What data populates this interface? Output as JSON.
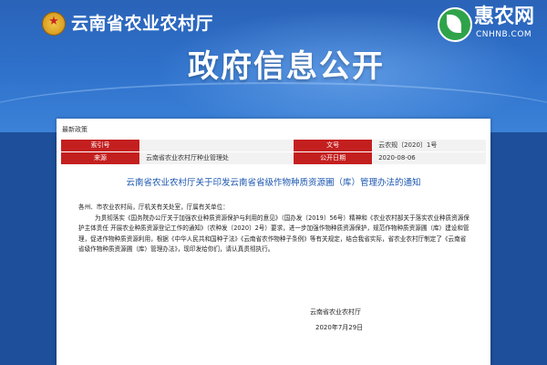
{
  "header": {
    "ministry_name": "云南省农业农村厅",
    "banner_title": "政府信息公开",
    "brand_name": "惠农网",
    "brand_domain": "CNHNB.COM"
  },
  "breadcrumb": "最新政策",
  "meta": {
    "index_label": "索引号",
    "index_value": "",
    "doc_label": "文号",
    "doc_value": "云农规〔2020〕1号",
    "source_label": "来源",
    "source_value": "云南省农业农村厅种业管理处",
    "date_label": "公开日期",
    "date_value": "2020-08-06"
  },
  "document": {
    "title": "云南省农业农村厅关于印发云南省省级作物种质资源圃（库）管理办法的通知",
    "salutation": "各州、市农业农村局，厅机关有关处室，厅属有关单位：",
    "paragraph": "为贯彻落实《国务院办公厅关于加强农业种质资源保护与利用的意见》（国办发〔2019〕56号）精神和《农业农村部关于落实农业种质资源保护主体责任 开展农业种质资源登记工作的通知》（农种发〔2020〕2号）要求，进一步加强作物种质资源保护，规范作物种质资源圃（库）建设和管理，促进作物种质资源利用，根据《中华人民共和国种子法》《云南省农作物种子条例》等有关规定，结合我省实际，省农业农村厅制定了《云南省省级作物种质资源圃（库）管理办法》，现印发给你们，请认真贯彻执行。",
    "signature": "云南省农业农村厅",
    "date": "2020年7月29日"
  },
  "colors": {
    "header_blue": "#2f72cc",
    "label_red": "#c41f1f",
    "title_blue": "#1a55b0"
  },
  "icons": {
    "emblem": "national-emblem-icon",
    "brand": "leaf-logo-icon"
  }
}
